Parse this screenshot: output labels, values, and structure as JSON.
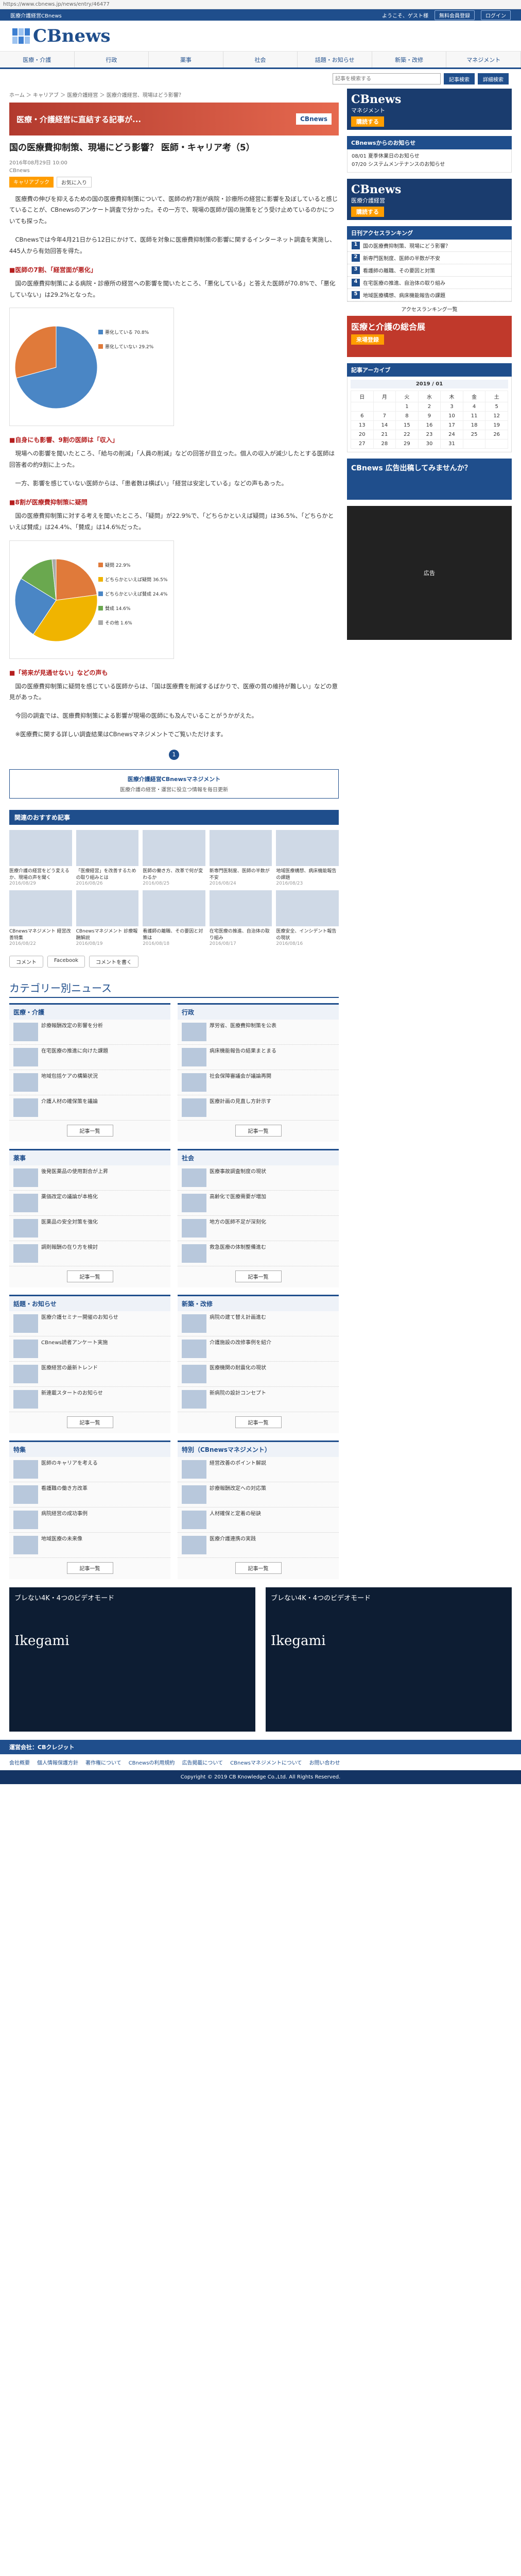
{
  "browser": {
    "url": "https://www.cbnews.jp/news/entry/46477"
  },
  "topbar": {
    "site": "医療介護経営CBnews",
    "welcome": "ようこそ、ゲスト様",
    "register": "無料会員登録",
    "login": "ログイン"
  },
  "logo": {
    "text": "CBnews"
  },
  "nav": [
    "医療・介護",
    "行政",
    "薬事",
    "社会",
    "話題・お知らせ",
    "新築・改修",
    "マネジメント"
  ],
  "search": {
    "placeholder": "記事を検索する",
    "button": "記事検索",
    "detail": "詳細検索"
  },
  "breadcrumb": "ホーム ＞ キャリアブ ＞ 医療介護経営 ＞ 医療介護経営、現場はどう影響？",
  "banner": {
    "text": "医療・介護経営に直結する記事が...",
    "badge": "CBnews"
  },
  "article": {
    "title": "国の医療費抑制策、現場にどう影響？ 医師・キャリア考（5）",
    "date": "2016年08月29日 10:00",
    "author": "CBnews",
    "tags": [
      "キャリアブック",
      "お気に入り"
    ],
    "paragraphs": [
      "医療費の伸びを抑えるための国の医療費抑制策について、医師の約7割が病院・診療所の経営に影響を及ぼしていると感じていることが、CBnewsのアンケート調査で分かった。その一方で、現場の医師が国の施策をどう受け止めているのかについても探った。",
      "CBnewsでは今年4月21日から12日にかけて、医師を対象に医療費抑制策の影響に関するインターネット調査を実施し、445人から有効回答を得た。"
    ],
    "h2_1": "■医師の7割、「経営面が悪化」",
    "p2": "国の医療費抑制策による病院・診療所の経営への影響を聞いたところ、「悪化している」と答えた医師が70.8%で、「悪化していない」は29.2%となった。",
    "h2_2": "■自身にも影響、9割の医師は「収入」",
    "p3": "現場への影響を聞いたところ、「給与の削減」「人員の削減」などの回答が目立った。個人の収入が減少したとする医師は回答者の約9割に上った。",
    "p4": "一方、影響を感じていない医師からは、「患者数は横ばい」「経営は安定している」などの声もあった。",
    "h2_3": "■8割が医療費抑制策に疑問",
    "p5": "国の医療費抑制策に対する考えを聞いたところ、「疑問」が22.9%で、「どちらかといえば疑問」は36.5%、「どちらかといえば賛成」は24.4%、「賛成」は14.6%だった。",
    "h2_4": "■「将来が見通せない」などの声も",
    "p6": "国の医療費抑制策に疑問を感じている医師からは、「国は医療費を削減するばかりで、医療の質の維持が難しい」などの意見があった。",
    "p7": "今回の調査では、医療費抑制策による影響が現場の医師にも及んでいることがうかがえた。",
    "p8": "※医療費に関する詳しい調査結果はCBnewsマネジメントでご覧いただけます。"
  },
  "pager": "1",
  "mag": {
    "title": "医療介護経営CBnewsマネジメント",
    "sub": "医療介護の経営・運営に役立つ情報を毎日更新"
  },
  "related": {
    "title": "関連のおすすめ記事",
    "items": [
      {
        "cap": "医療介護の経営をどう変えるか、現場の声を聞く",
        "date": "2016/08/29"
      },
      {
        "cap": "「医療経営」を改善するための取り組みとは",
        "date": "2016/08/26"
      },
      {
        "cap": "医師の働き方、改革で何が変わるか",
        "date": "2016/08/25"
      },
      {
        "cap": "新専門医制度、医師の半数が不安",
        "date": "2016/08/24"
      },
      {
        "cap": "地域医療構想、病床機能報告の課題",
        "date": "2016/08/23"
      },
      {
        "cap": "CBnewsマネジメント 経営改善特集",
        "date": "2016/08/22"
      },
      {
        "cap": "CBnewsマネジメント 診療報酬解説",
        "date": "2016/08/19"
      },
      {
        "cap": "看護師の離職、その要因と対策は",
        "date": "2016/08/18"
      },
      {
        "cap": "在宅医療の推進、自治体の取り組み",
        "date": "2016/08/17"
      },
      {
        "cap": "医療安全、インシデント報告の現状",
        "date": "2016/08/16"
      }
    ]
  },
  "share": [
    "コメント",
    "Facebook",
    "コメントを書く"
  ],
  "categories": {
    "title": "カテゴリー別ニュース",
    "more": "記事一覧",
    "groups": [
      {
        "name": "医療・介護",
        "items": [
          "診療報酬改定の影響を分析",
          "在宅医療の推進に向けた課題",
          "地域包括ケアの構築状況",
          "介護人材の確保策を議論"
        ]
      },
      {
        "name": "行政",
        "items": [
          "厚労省、医療費抑制策を公表",
          "病床機能報告の結果まとまる",
          "社会保障審議会が議論再開",
          "医療計画の見直し方針示す"
        ]
      },
      {
        "name": "薬事",
        "items": [
          "後発医薬品の使用割合が上昇",
          "薬価改定の議論が本格化",
          "医薬品の安全対策を強化",
          "調剤報酬の在り方を検討"
        ]
      },
      {
        "name": "社会",
        "items": [
          "医療事故調査制度の現状",
          "高齢化で医療需要が増加",
          "地方の医師不足が深刻化",
          "救急医療の体制整備進む"
        ]
      },
      {
        "name": "話題・お知らせ",
        "items": [
          "医療介護セミナー開催のお知らせ",
          "CBnews読者アンケート実施",
          "医療経営の最新トレンド",
          "新連載スタートのお知らせ"
        ]
      },
      {
        "name": "新築・改修",
        "items": [
          "病院の建て替え計画進む",
          "介護施設の改修事例を紹介",
          "医療機関の耐震化の現状",
          "新病院の設計コンセプト"
        ]
      },
      {
        "name": "特集",
        "items": [
          "医師のキャリアを考える",
          "看護職の働き方改革",
          "病院経営の成功事例",
          "地域医療の未来像"
        ]
      },
      {
        "name": "特別（CBnewsマネジメント）",
        "items": [
          "経営改善のポイント解説",
          "診療報酬改定への対応策",
          "人材確保と定着の秘訣",
          "医療介護連携の実践"
        ]
      }
    ]
  },
  "side": {
    "ad1": {
      "title": "CBnews",
      "sub": "マネジメント",
      "cta": "購読する"
    },
    "notice_title": "CBnewsからのお知らせ",
    "notices": [
      "08/01 夏季休業日のお知らせ",
      "07/20 システムメンテナンスのお知らせ"
    ],
    "ad2": {
      "title": "CBnews",
      "sub": "医療介護経営",
      "cta": "購読する"
    },
    "rank_title": "日刊アクセスランキング",
    "ranks": [
      "国の医療費抑制策、現場にどう影響？",
      "新専門医制度、医師の半数が不安",
      "看護師の離職、その要因と対策",
      "在宅医療の推進、自治体の取り組み",
      "地域医療構想、病床機能報告の課題"
    ],
    "rank_more": "アクセスランキング一覧",
    "ad3": {
      "title": "医療と介護の総合展",
      "cta": "来場登録"
    },
    "cal_title": "記事アーカイブ",
    "cal_month": "2019 / 01",
    "cal_days": [
      "日",
      "月",
      "火",
      "水",
      "木",
      "金",
      "土"
    ],
    "cal_rows": [
      [
        "",
        "",
        "1",
        "2",
        "3",
        "4",
        "5"
      ],
      [
        "6",
        "7",
        "8",
        "9",
        "10",
        "11",
        "12"
      ],
      [
        "13",
        "14",
        "15",
        "16",
        "17",
        "18",
        "19"
      ],
      [
        "20",
        "21",
        "22",
        "23",
        "24",
        "25",
        "26"
      ],
      [
        "27",
        "28",
        "29",
        "30",
        "31",
        "",
        ""
      ]
    ],
    "ad4": {
      "title": "CBnews 広告出稿してみませんか？"
    },
    "ad5": "広告"
  },
  "bottom_ads": [
    {
      "top": "ブレない4K・4つのビデオモード",
      "big": "Ikegami"
    },
    {
      "top": "ブレない4K・4つのビデオモード",
      "big": "Ikegami"
    }
  ],
  "footer": {
    "company": "運営会社：CBクレジット",
    "links": [
      "会社概要",
      "個人情報保護方針",
      "著作権について",
      "CBnewsの利用規約",
      "広告掲載について",
      "CBnewsマネジメントについて",
      "お問い合わせ"
    ],
    "copyright": "Copyright © 2019 CB Knowledge Co.,Ltd. All Rights Reserved."
  },
  "chart_data": [
    {
      "type": "pie",
      "title": "",
      "values": [
        70.8,
        29.2
      ],
      "labels": [
        "悪化している 70.8%",
        "悪化していない 29.2%"
      ],
      "colors": [
        "#4a86c5",
        "#e07a3a"
      ]
    },
    {
      "type": "pie",
      "title": "",
      "values": [
        22.9,
        36.5,
        24.4,
        14.6,
        1.6
      ],
      "labels": [
        "疑問 22.9%",
        "どちらかといえば疑問 36.5%",
        "どちらかといえば賛成 24.4%",
        "賛成 14.6%",
        "その他 1.6%"
      ],
      "colors": [
        "#e07a3a",
        "#f0b400",
        "#4a86c5",
        "#6aa84f",
        "#aaa"
      ]
    }
  ]
}
